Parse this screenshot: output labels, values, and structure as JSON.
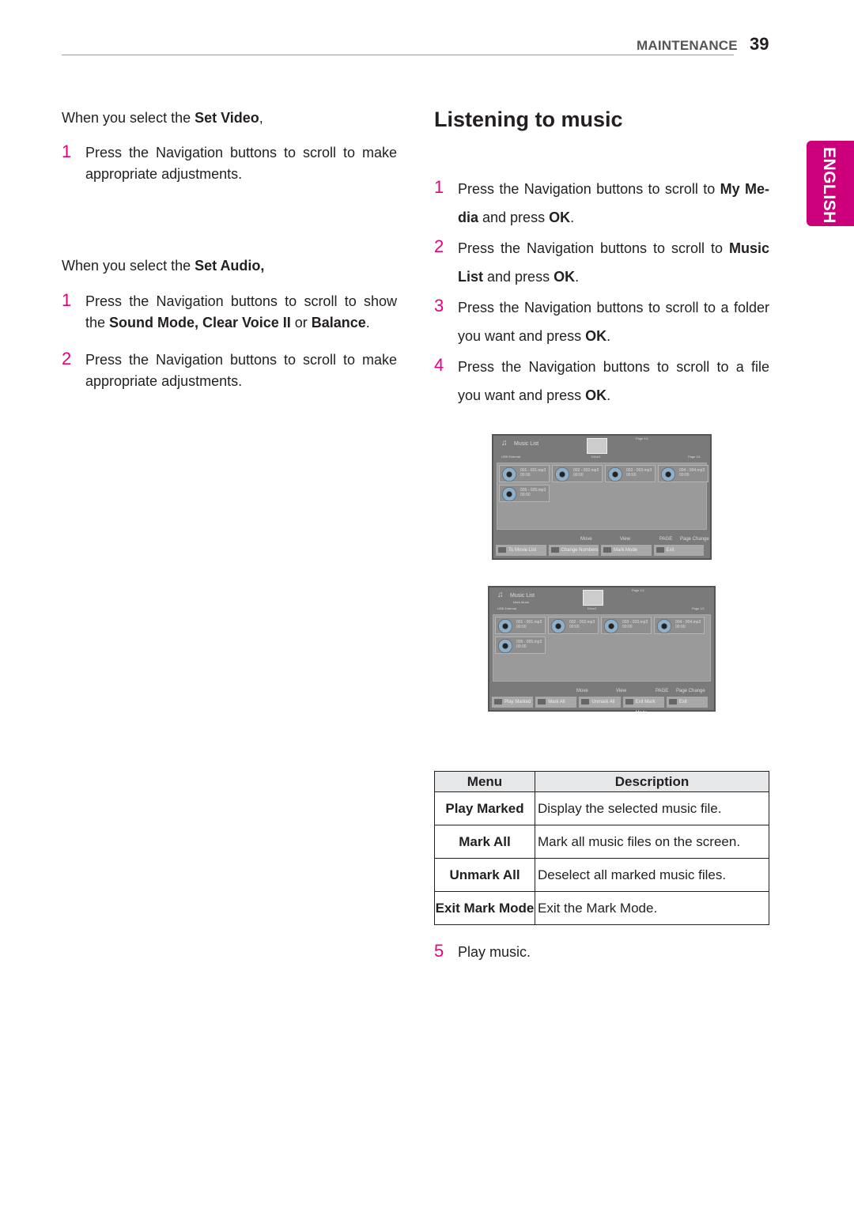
{
  "header": {
    "section": "MAINTENANCE",
    "page_number": "39"
  },
  "language_tab": "ENGLISH",
  "left": {
    "video_intro": [
      {
        "t": "When you select the "
      },
      {
        "t": "Set Video",
        "b": true
      },
      {
        "t": ","
      }
    ],
    "video_steps": [
      {
        "n": "1",
        "segs": [
          {
            "t": "Press the Navigation buttons to scroll to make appropriate adjustments."
          }
        ]
      }
    ],
    "audio_intro": [
      {
        "t": "When you select the "
      },
      {
        "t": "Set Audio,",
        "b": true
      }
    ],
    "audio_steps": [
      {
        "n": "1",
        "segs": [
          {
            "t": "Press the Navigation buttons to scroll to show the "
          },
          {
            "t": "Sound Mode, Clear Voice II",
            "b": true
          },
          {
            "t": " or "
          },
          {
            "t": "Balance",
            "b": true
          },
          {
            "t": "."
          }
        ]
      },
      {
        "n": "2",
        "segs": [
          {
            "t": "Press the Navigation buttons to scroll to make appropriate adjustments."
          }
        ]
      }
    ]
  },
  "right": {
    "title": "Listening to music",
    "steps": [
      {
        "n": "1",
        "segs": [
          {
            "t": "Press the Navigation buttons to scroll to "
          },
          {
            "t": "My Me-dia",
            "b": true
          },
          {
            "t": " and press "
          },
          {
            "t": "OK",
            "b": true
          },
          {
            "t": "."
          }
        ]
      },
      {
        "n": "2",
        "segs": [
          {
            "t": "Press the Navigation buttons to scroll to "
          },
          {
            "t": "Music List",
            "b": true
          },
          {
            "t": " and press "
          },
          {
            "t": "OK",
            "b": true
          },
          {
            "t": "."
          }
        ]
      },
      {
        "n": "3",
        "segs": [
          {
            "t": "Press the Navigation buttons to scroll to a folder you want and press "
          },
          {
            "t": "OK",
            "b": true
          },
          {
            "t": "."
          }
        ]
      },
      {
        "n": "4",
        "segs": [
          {
            "t": "Press the Navigation buttons to scroll to a file you want and press "
          },
          {
            "t": "OK",
            "b": true
          },
          {
            "t": "."
          }
        ]
      }
    ],
    "step5": {
      "n": "5",
      "segs": [
        {
          "t": "Play music."
        }
      ]
    }
  },
  "screens": [
    {
      "title": "Music List",
      "subtitle": "",
      "source": "USB External",
      "folder": "Drive1",
      "page_top": "Page 1/1",
      "page_right": "Page 1/1",
      "files": [
        {
          "name": "001 - 001.mp3",
          "time": "00:00"
        },
        {
          "name": "002 - 002.mp3",
          "time": "00:00"
        },
        {
          "name": "003 - 003.mp3",
          "time": "00:00"
        },
        {
          "name": "004 - 004.mp3",
          "time": "00:00"
        },
        {
          "name": "005 - 005.mp3",
          "time": "00:00"
        }
      ],
      "hints": [
        "Move",
        "View",
        "PAGE",
        "Page Change"
      ],
      "buttons": [
        "To Movie List",
        "Change Numbers",
        "Mark Mode",
        "Exit"
      ]
    },
    {
      "title": "Music List",
      "subtitle": "Mark Mode",
      "source": "USB External",
      "folder": "Drive1",
      "page_top": "Page 1/1",
      "page_right": "Page 1/1",
      "files": [
        {
          "name": "001 - 001.mp3",
          "time": "00:00"
        },
        {
          "name": "002 - 002.mp3",
          "time": "00:00"
        },
        {
          "name": "003 - 003.mp3",
          "time": "00:00"
        },
        {
          "name": "004 - 004.mp3",
          "time": "00:00"
        },
        {
          "name": "005 - 005.mp3",
          "time": "00:00"
        }
      ],
      "hints": [
        "Move",
        "View",
        "PAGE",
        "Page Change"
      ],
      "buttons": [
        "Play Marked",
        "Mark All",
        "Unmark All",
        "Exit Mark Mode",
        "Exit"
      ]
    }
  ],
  "table": {
    "headers": [
      "Menu",
      "Description"
    ],
    "rows": [
      [
        "Play Marked",
        "Display the selected music file."
      ],
      [
        "Mark All",
        "Mark all music files on the screen."
      ],
      [
        "Unmark All",
        "Deselect all marked music files."
      ],
      [
        "Exit Mark Mode",
        "Exit the Mark Mode."
      ]
    ]
  }
}
